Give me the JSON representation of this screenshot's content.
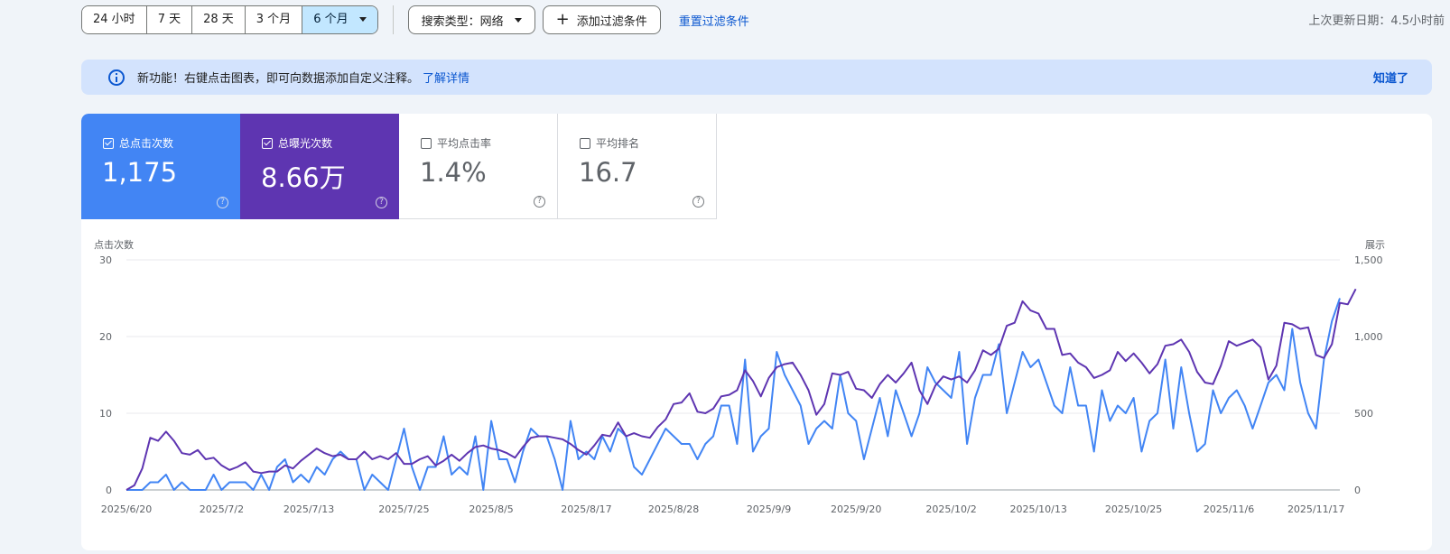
{
  "toolbar": {
    "date_ranges": [
      "24 小时",
      "7 天",
      "28 天",
      "3 个月",
      "6 个月"
    ],
    "search_type": "搜索类型：网络",
    "add_filter": "添加过滤条件",
    "reset_filters": "重置过滤条件",
    "last_updated": "上次更新日期：4.5小时前"
  },
  "banner": {
    "text": "新功能！右键点击图表，即可向数据添加自定义注释。",
    "link": "了解详情",
    "dismiss": "知道了"
  },
  "metrics": [
    {
      "label": "总点击次数",
      "value": "1,175",
      "checked": true,
      "color": "#4285f4"
    },
    {
      "label": "总曝光次数",
      "value": "8.66万",
      "checked": true,
      "color": "#5e35b1"
    },
    {
      "label": "平均点击率",
      "value": "1.4%",
      "checked": false
    },
    {
      "label": "平均排名",
      "value": "16.7",
      "checked": false
    }
  ],
  "icons": {
    "info": "info-icon",
    "help": "help-icon",
    "plus": "plus-icon",
    "dropdown": "chevron-down-icon",
    "checkbox": "checkbox-icon"
  },
  "chart_data": {
    "type": "line",
    "ylabel": "点击次数",
    "y2label": "展示",
    "ylim": [
      0,
      30
    ],
    "y2lim": [
      0,
      1500
    ],
    "y_ticks": [
      "0",
      "10",
      "20",
      "30"
    ],
    "y2_ticks": [
      "0",
      "500",
      "1,000",
      "1,500"
    ],
    "x_ticks": [
      "2025/6/20",
      "2025/7/2",
      "2025/7/13",
      "2025/7/25",
      "2025/8/5",
      "2025/8/17",
      "2025/8/28",
      "2025/9/9",
      "2025/9/20",
      "2025/10/2",
      "2025/10/13",
      "2025/10/25",
      "2025/11/6",
      "2025/11/17"
    ],
    "grid": true,
    "legend": "none",
    "series": [
      {
        "name": "总点击次数",
        "axis": "left",
        "color": "#4285f4",
        "values": [
          0,
          0,
          0,
          1,
          1,
          2,
          0,
          1,
          0,
          0,
          0,
          2,
          0,
          1,
          1,
          1,
          0,
          2,
          0,
          3,
          4,
          1,
          2,
          1,
          3,
          2,
          4,
          5,
          4,
          4,
          0,
          2,
          1,
          0,
          4,
          8,
          3,
          0,
          3,
          3,
          7,
          2,
          3,
          2,
          7,
          0,
          9,
          4,
          4,
          1,
          5,
          8,
          7,
          7,
          4,
          0,
          9,
          4,
          5,
          4,
          7,
          5,
          8,
          7,
          3,
          2,
          4,
          6,
          8,
          7,
          6,
          6,
          4,
          6,
          7,
          11,
          11,
          6,
          17,
          5,
          7,
          8,
          18,
          15,
          13,
          11,
          6,
          8,
          9,
          8,
          15,
          10,
          9,
          4,
          8,
          12,
          7,
          13,
          10,
          7,
          10,
          16,
          14,
          13,
          12,
          18,
          6,
          12,
          15,
          15,
          19,
          10,
          14,
          18,
          16,
          17,
          14,
          11,
          10,
          16,
          11,
          11,
          5,
          13,
          9,
          11,
          10,
          12,
          5,
          9,
          10,
          17,
          8,
          16,
          10,
          5,
          6,
          13,
          10,
          12,
          13,
          11,
          8,
          11,
          14,
          15,
          13,
          21,
          14,
          10,
          8,
          17,
          22,
          25
        ]
      },
      {
        "name": "总曝光次数",
        "axis": "right",
        "color": "#5e35b1",
        "values": [
          0,
          30,
          140,
          340,
          320,
          380,
          320,
          240,
          230,
          260,
          200,
          210,
          160,
          130,
          150,
          180,
          120,
          110,
          120,
          120,
          160,
          140,
          190,
          230,
          270,
          240,
          220,
          230,
          200,
          200,
          250,
          200,
          220,
          200,
          240,
          170,
          170,
          200,
          220,
          160,
          190,
          230,
          190,
          240,
          280,
          290,
          270,
          260,
          240,
          210,
          280,
          340,
          350,
          350,
          340,
          330,
          300,
          260,
          230,
          290,
          360,
          350,
          440,
          350,
          370,
          350,
          340,
          410,
          460,
          560,
          570,
          630,
          510,
          500,
          530,
          610,
          620,
          650,
          780,
          710,
          610,
          730,
          800,
          820,
          830,
          750,
          650,
          490,
          560,
          760,
          750,
          770,
          660,
          650,
          600,
          690,
          750,
          700,
          760,
          830,
          650,
          560,
          680,
          740,
          720,
          740,
          700,
          780,
          910,
          880,
          920,
          1070,
          1090,
          1230,
          1170,
          1150,
          1050,
          1050,
          880,
          890,
          830,
          800,
          730,
          750,
          780,
          900,
          840,
          890,
          830,
          760,
          820,
          940,
          950,
          980,
          900,
          770,
          700,
          690,
          810,
          970,
          940,
          960,
          980,
          930,
          720,
          810,
          1090,
          1080,
          1050,
          1060,
          880,
          860,
          950,
          1220,
          1210,
          1310
        ]
      }
    ]
  }
}
